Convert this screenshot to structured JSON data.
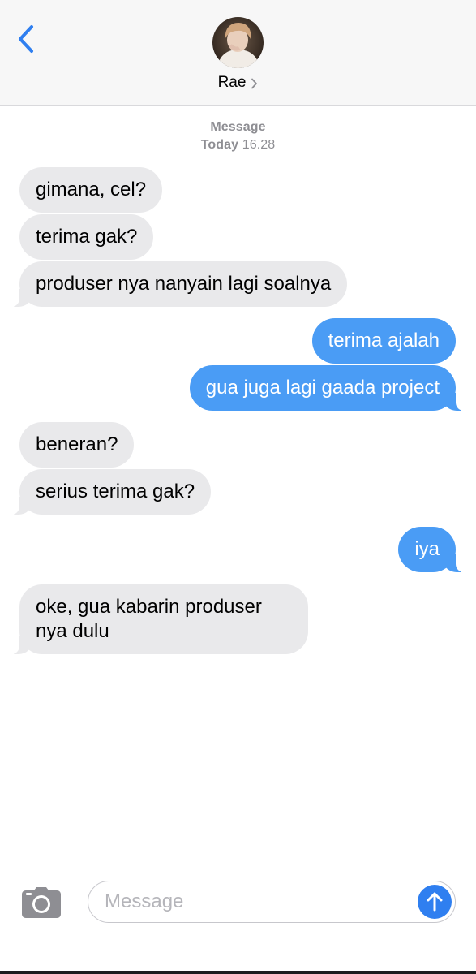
{
  "header": {
    "contact_name": "Rae",
    "back_icon": "chevron-left-icon",
    "avatar_alt": "contact avatar"
  },
  "timestamp": {
    "service": "Message",
    "day": "Today",
    "time": "16.28"
  },
  "messages": [
    {
      "side": "received",
      "text": "gimana, cel?"
    },
    {
      "side": "received",
      "text": "terima gak?"
    },
    {
      "side": "received",
      "text": "produser nya nanyain lagi soalnya"
    },
    {
      "side": "sent",
      "text": "terima ajalah"
    },
    {
      "side": "sent",
      "text": "gua juga lagi gaada project"
    },
    {
      "side": "received",
      "text": "beneran?"
    },
    {
      "side": "received",
      "text": "serius terima gak?"
    },
    {
      "side": "sent",
      "text": "iya"
    },
    {
      "side": "received",
      "text": "oke, gua kabarin produser nya dulu"
    }
  ],
  "composer": {
    "placeholder": "Message",
    "value": "",
    "camera_icon": "camera-icon",
    "send_icon": "arrow-up-icon"
  },
  "colors": {
    "accent": "#2f7ff0",
    "sent_bubble": "#4a9cf5",
    "received_bubble": "#e9e9eb",
    "header_bg": "#f7f7f7",
    "secondary_text": "#8e8e93"
  }
}
